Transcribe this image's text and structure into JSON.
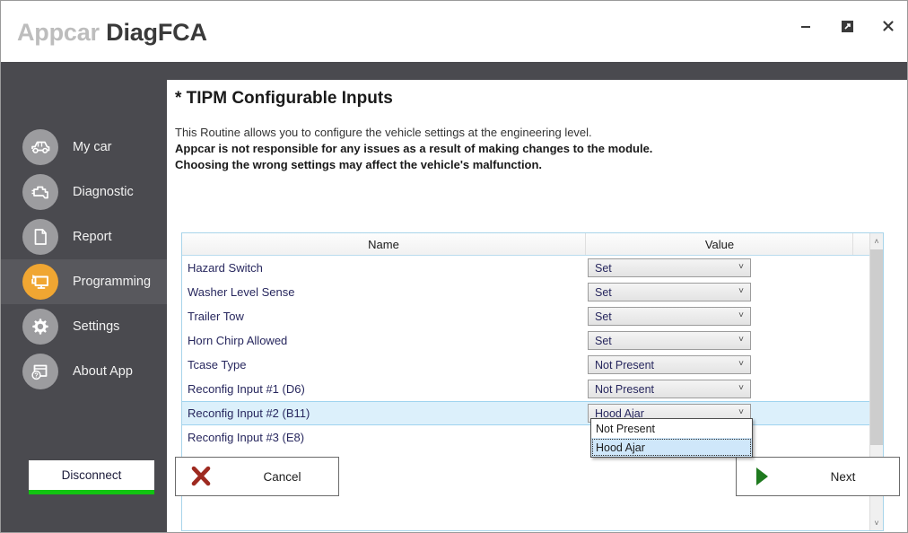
{
  "window": {
    "title_light": "Appcar",
    "title_dark": "DiagFCA",
    "controls": {
      "minimize": "minimize-icon",
      "maximize": "restore-icon",
      "close": "close-icon"
    }
  },
  "sidebar": {
    "items": [
      {
        "label": "My car",
        "icon": "car-icon",
        "active": false
      },
      {
        "label": "Diagnostic",
        "icon": "engine-icon",
        "active": false
      },
      {
        "label": "Report",
        "icon": "document-icon",
        "active": false
      },
      {
        "label": "Programming",
        "icon": "monitor-play-icon",
        "active": true
      },
      {
        "label": "Settings",
        "icon": "gear-icon",
        "active": false
      },
      {
        "label": "About App",
        "icon": "window-help-icon",
        "active": false
      }
    ],
    "disconnect_label": "Disconnect",
    "accent_color": "#f0a632",
    "disconnect_bar_color": "#11c411"
  },
  "main": {
    "title": "* TIPM Configurable Inputs",
    "description_line1": "This Routine allows you to configure the vehicle settings at the engineering level.",
    "description_line2": "Appcar is not responsible for any issues as a result of making changes to the module.",
    "description_line3": "Choosing the wrong settings may affect the vehicle's malfunction.",
    "table": {
      "columns": [
        "Name",
        "Value"
      ],
      "rows": [
        {
          "name": "Hazard Switch",
          "value": "Set",
          "selected": false
        },
        {
          "name": "Washer Level Sense",
          "value": "Set",
          "selected": false
        },
        {
          "name": "Trailer Tow",
          "value": "Set",
          "selected": false
        },
        {
          "name": "Horn Chirp Allowed",
          "value": "Set",
          "selected": false
        },
        {
          "name": "Tcase Type",
          "value": "Not Present",
          "selected": false
        },
        {
          "name": "Reconfig Input #1 (D6)",
          "value": "Not Present",
          "selected": false
        },
        {
          "name": "Reconfig Input #2 (B11)",
          "value": "Hood Ajar",
          "selected": true
        },
        {
          "name": "Reconfig Input #3 (E8)",
          "value": "",
          "selected": false
        }
      ]
    },
    "open_dropdown": {
      "row": "Reconfig Input #2 (B11)",
      "options": [
        "Not Present",
        "Hood Ajar"
      ],
      "highlighted": "Hood Ajar"
    },
    "buttons": {
      "cancel": "Cancel",
      "next": "Next",
      "cancel_icon_color": "#9e2a20",
      "next_icon_color": "#1f7a1f"
    }
  },
  "scrollbar": {
    "up_arrow": "chevron-up-icon",
    "down_arrow": "chevron-down-icon"
  }
}
